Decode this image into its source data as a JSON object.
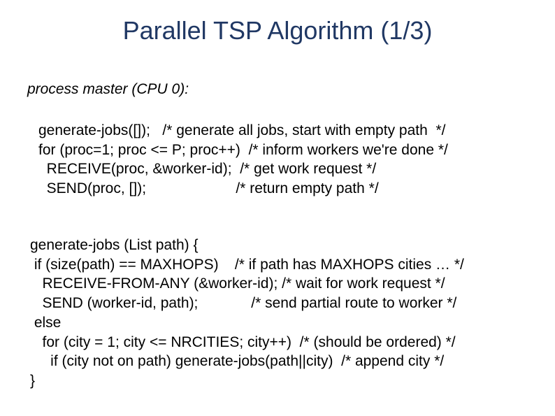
{
  "title": "Parallel TSP Algorithm (1/3)",
  "subtitle": "process master (CPU 0):",
  "block1_lines": {
    "l0": "generate-jobs([]);   /* generate all jobs, start with empty path  */",
    "l1": "for (proc=1; proc <= P; proc++)  /* inform workers we're done */",
    "l2": "  RECEIVE(proc, &worker-id);  /* get work request */",
    "l3": "  SEND(proc, []);                      /* return empty path */"
  },
  "block2_lines": {
    "l0": "generate-jobs (List path) {",
    "l1": " if (size(path) == MAXHOPS)    /* if path has MAXHOPS cities … */",
    "l2": "   RECEIVE-FROM-ANY (&worker-id); /* wait for work request */",
    "l3": "   SEND (worker-id, path);             /* send partial route to worker */",
    "l4": " else",
    "l5": "   for (city = 1; city <= NRCITIES; city++)  /* (should be ordered) */",
    "l6": "     if (city not on path) generate-jobs(path||city)  /* append city */",
    "l7": "}"
  }
}
